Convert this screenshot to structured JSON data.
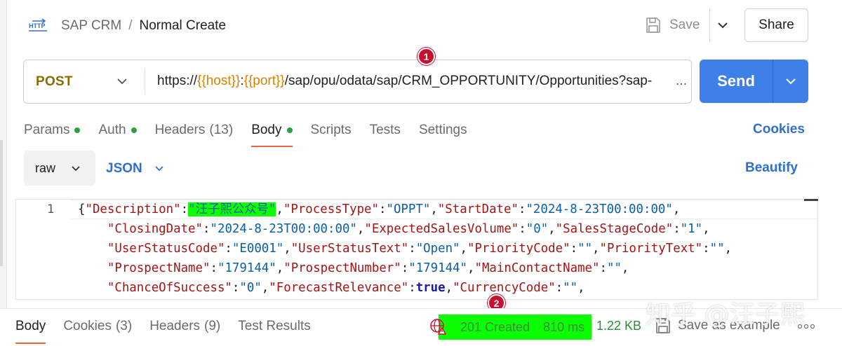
{
  "header": {
    "http_badge": "HTTP",
    "collection": "SAP CRM",
    "separator": "/",
    "request_name": "Normal Create",
    "save_label": "Save",
    "share_label": "Share"
  },
  "request": {
    "method": "POST",
    "url_prefix": "https://",
    "url_var_host": "{{host}}",
    "url_colon": ":",
    "url_var_port": "{{port}}",
    "url_path": "/sap/opu/odata/sap/CRM_OPPORTUNITY/Opportunities?sap-",
    "url_ellipsis": "...",
    "send_label": "Send"
  },
  "annotations": {
    "badge_1": "1",
    "badge_2": "2"
  },
  "tabs": [
    {
      "label": "Params",
      "dot": true
    },
    {
      "label": "Auth",
      "dot": true
    },
    {
      "label": "Headers",
      "count": "(13)"
    },
    {
      "label": "Body",
      "dot": true,
      "active": true
    },
    {
      "label": "Scripts"
    },
    {
      "label": "Tests"
    },
    {
      "label": "Settings"
    }
  ],
  "cookies_link": "Cookies",
  "body_options": {
    "mode": "raw",
    "format": "JSON",
    "beautify_label": "Beautify"
  },
  "editor": {
    "line_number": "1",
    "lines": [
      "{\"Description\":\"汪子熙公众号\",\"ProcessType\":\"OPPT\",\"StartDate\":\"2024-8-23T00:00:00\",",
      "    \"ClosingDate\":\"2024-8-23T00:00:00\",\"ExpectedSalesVolume\":\"0\",\"SalesStageCode\":\"1\",",
      "    \"UserStatusCode\":\"E0001\",\"UserStatusText\":\"Open\",\"PriorityCode\":\"\",\"PriorityText\":\"\",",
      "    \"ProspectName\":\"179144\",\"ProspectNumber\":\"179144\",\"MainContactName\":\"\",",
      "    \"ChanceOfSuccess\":\"0\",\"ForecastRelevance\":true,\"CurrencyCode\":\"\","
    ]
  },
  "response": {
    "tabs": [
      {
        "label": "Body",
        "active": true
      },
      {
        "label": "Cookies",
        "count": "(3)"
      },
      {
        "label": "Headers",
        "count": "(9)"
      },
      {
        "label": "Test Results"
      }
    ],
    "status": "201 Created",
    "time": "810 ms",
    "size": "1.22 KB",
    "save_example_label": "Save as example",
    "more": "⋯"
  },
  "watermark": "知乎 @汪子熙",
  "colors": {
    "send": "#3f7fe8",
    "method": "#8a6b00",
    "variable": "#d68000",
    "link": "#2f6fd1",
    "highlight": "#0bff00",
    "tab_underline": "#e8663d",
    "badge": "#c8102e"
  },
  "icons": {
    "http": "http-file-icon",
    "save": "floppy-disk-icon",
    "chevron": "chevron-down-icon",
    "globe": "globe-warning-icon",
    "more": "more-dots-icon"
  }
}
